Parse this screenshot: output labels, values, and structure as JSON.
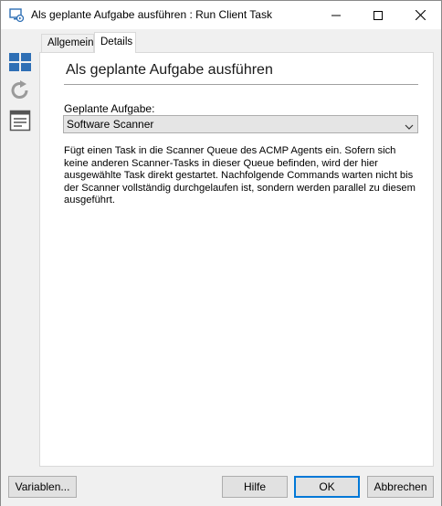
{
  "window": {
    "title": "Als geplante Aufgabe ausführen : Run Client Task"
  },
  "tabs": [
    {
      "label": "Allgemein",
      "active": false
    },
    {
      "label": "Details",
      "active": true
    }
  ],
  "sidebar": {
    "icons": [
      "dashboard-icon",
      "refresh-icon",
      "list-icon"
    ]
  },
  "details": {
    "heading": "Als geplante Aufgabe ausführen",
    "field_label": "Geplante Aufgabe:",
    "selected_task": "Software Scanner",
    "description": "Fügt einen Task in die Scanner Queue des ACMP Agents ein. Sofern sich keine anderen Scanner-Tasks in dieser Queue befinden, wird der hier ausgewählte Task direkt gestartet. Nachfolgende Commands warten nicht bis der Scanner vollständig durchgelaufen ist, sondern werden parallel zu diesem ausgeführt."
  },
  "buttons": {
    "variables": "Variablen...",
    "help": "Hilfe",
    "ok": "OK",
    "cancel": "Abbrechen"
  },
  "colors": {
    "accent": "#0078d7",
    "icon_blue": "#2e6fb5",
    "panel_bg": "#ffffff",
    "chrome_bg": "#f0f0f0"
  }
}
